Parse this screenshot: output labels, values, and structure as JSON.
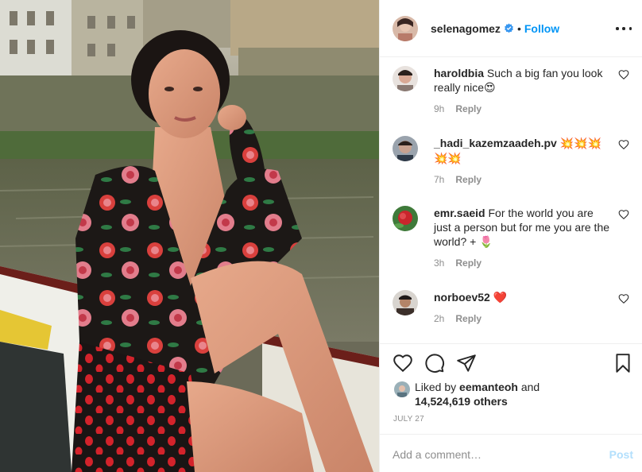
{
  "header": {
    "username": "selenagomez",
    "dot": "•",
    "follow_label": "Follow",
    "verified": true
  },
  "comments": [
    {
      "username": "haroldbia",
      "text": "Such a big fan you look really nice",
      "emoji": "😍",
      "time": "9h",
      "reply_label": "Reply"
    },
    {
      "username": "_hadi_kazemzaadeh.pv",
      "text": "",
      "emoji": "💥💥💥💥💥",
      "time": "7h",
      "reply_label": "Reply"
    },
    {
      "username": "emr.saeid",
      "text": "For the world you are just a person but for me you are the world? +",
      "emoji": "🌷",
      "time": "3h",
      "reply_label": "Reply"
    },
    {
      "username": "norboev52",
      "text": "",
      "emoji": "❤️",
      "time": "2h",
      "reply_label": "Reply"
    }
  ],
  "likes": {
    "prefix": "Liked by",
    "user": "eemanteoh",
    "and": "and",
    "count": "14,524,619 others"
  },
  "date": "JULY 27",
  "add_comment": {
    "placeholder": "Add a comment…",
    "post_label": "Post"
  },
  "icons": {
    "like": "heart-icon",
    "comment": "comment-icon",
    "share": "send-icon",
    "save": "bookmark-icon",
    "more": "more-options-icon",
    "verified": "verified-badge-icon"
  },
  "colors": {
    "link": "#0095f6",
    "muted": "#8e8e8e",
    "post_disabled": "#b2dffc",
    "text": "#262626"
  }
}
